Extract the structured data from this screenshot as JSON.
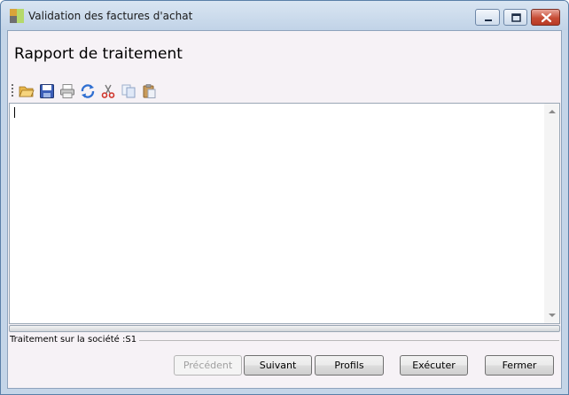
{
  "window": {
    "title": "Validation des factures d'achat",
    "icon": "app-icon",
    "controls": [
      "minimize-icon",
      "maximize-icon",
      "close-icon"
    ]
  },
  "page": {
    "heading": "Rapport de traitement"
  },
  "toolbar": {
    "items": [
      {
        "name": "open-folder-icon"
      },
      {
        "name": "save-icon"
      },
      {
        "name": "print-icon"
      },
      {
        "name": "refresh-icon"
      },
      {
        "name": "cut-icon"
      },
      {
        "name": "copy-icon"
      },
      {
        "name": "paste-icon"
      }
    ]
  },
  "editor": {
    "content": ""
  },
  "status": {
    "text": "Traitement sur la société :S1"
  },
  "buttons": {
    "previous": "Précédent",
    "next": "Suivant",
    "profiles": "Profils",
    "execute": "Exécuter",
    "close": "Fermer"
  },
  "colors": {
    "titlebar": "#c4d5e8",
    "client_bg": "#f6f2f6",
    "close_button": "#c74c35",
    "accent_blue": "#2f6fd1"
  }
}
